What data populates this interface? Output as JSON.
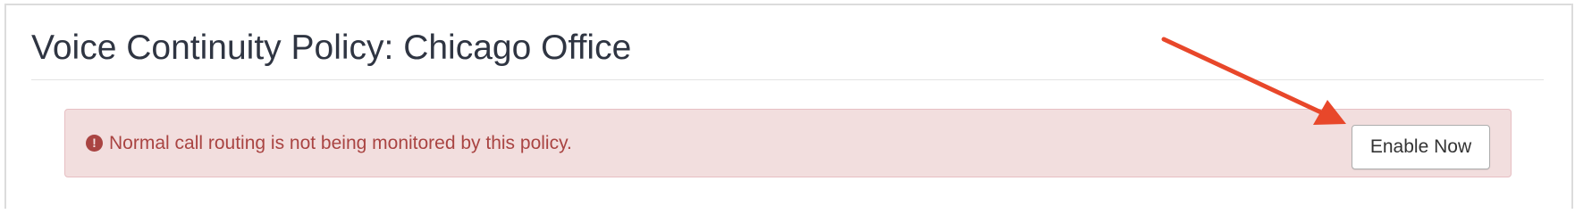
{
  "page": {
    "title": "Voice Continuity Policy: Chicago Office"
  },
  "alert": {
    "icon": "exclamation-circle-icon",
    "message": "Normal call routing is not being monitored by this policy.",
    "button_label": "Enable Now"
  },
  "annotation": {
    "type": "arrow",
    "target": "enable-now-button",
    "color": "#e8472a"
  },
  "colors": {
    "alert_background": "#f2dede",
    "alert_text": "#a94442",
    "title_text": "#2f3542"
  }
}
